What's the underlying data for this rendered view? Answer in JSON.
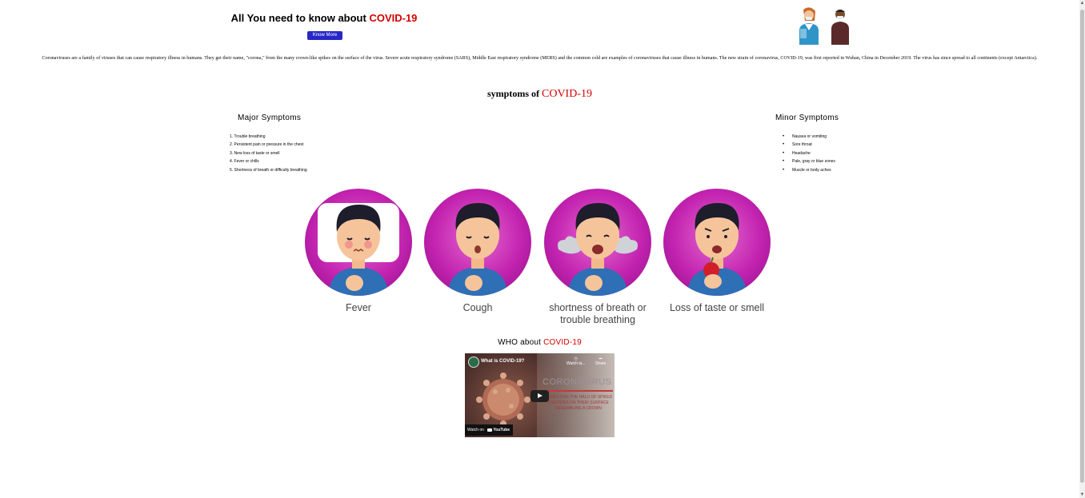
{
  "hero": {
    "title_prefix": "All You need to know about ",
    "title_highlight": "COVID-19",
    "button_label": "Know More"
  },
  "intro": "Coronaviruses are a family of viruses that can cause respiratory illness in humans. They get their name, \"corona,\" from the many crown-like spikes on the surface of the virus. Severe acute respiratory syndrome (SARS), Middle East respiratory syndrome (MERS) and the common cold are examples of coronaviruses that cause illness in humans. The new strain of coronavirus, COVID-19, was first reported in Wuhan, China in December 2019. The virus has since spread to all continents (except Antarctica).",
  "symptoms": {
    "title_prefix": "symptoms of ",
    "title_highlight": "COVID-19",
    "major_heading": "Major Symptoms",
    "minor_heading": "Minor Symptoms",
    "major": [
      "1. Trouble breathing",
      "2. Persistent pain or pressure in the chest",
      "3. New loss of taste or smell",
      "4. Fever or chills",
      "5. Shortness of breath or difficulty breathing"
    ],
    "minor": [
      "Nausea or vomiting",
      "Sore throat",
      "Headache",
      "Pale, gray or blue zones",
      "Muscle or body aches"
    ]
  },
  "cards": [
    {
      "label": "Fever"
    },
    {
      "label": "Cough"
    },
    {
      "label": "shortness of breath or trouble breathing"
    },
    {
      "label": "Loss of taste or smell"
    }
  ],
  "who": {
    "prefix": "WHO about ",
    "highlight": "COVID-19"
  },
  "video": {
    "title": "What is COVID-19?",
    "watch_later": "Watch la...",
    "share": "Share",
    "big_text": "CORONAVIRUS",
    "small_text": "NAMED FOR THE HALO OF SPIKED PROTEINS ON THEIR SURFACE RESEMBLING A CROWN",
    "watch_on": "Watch on",
    "youtube": "YouTube"
  },
  "colors": {
    "accent_red": "#d40000",
    "button_blue": "#2727c6",
    "circle_magenta": "#c324b0"
  }
}
